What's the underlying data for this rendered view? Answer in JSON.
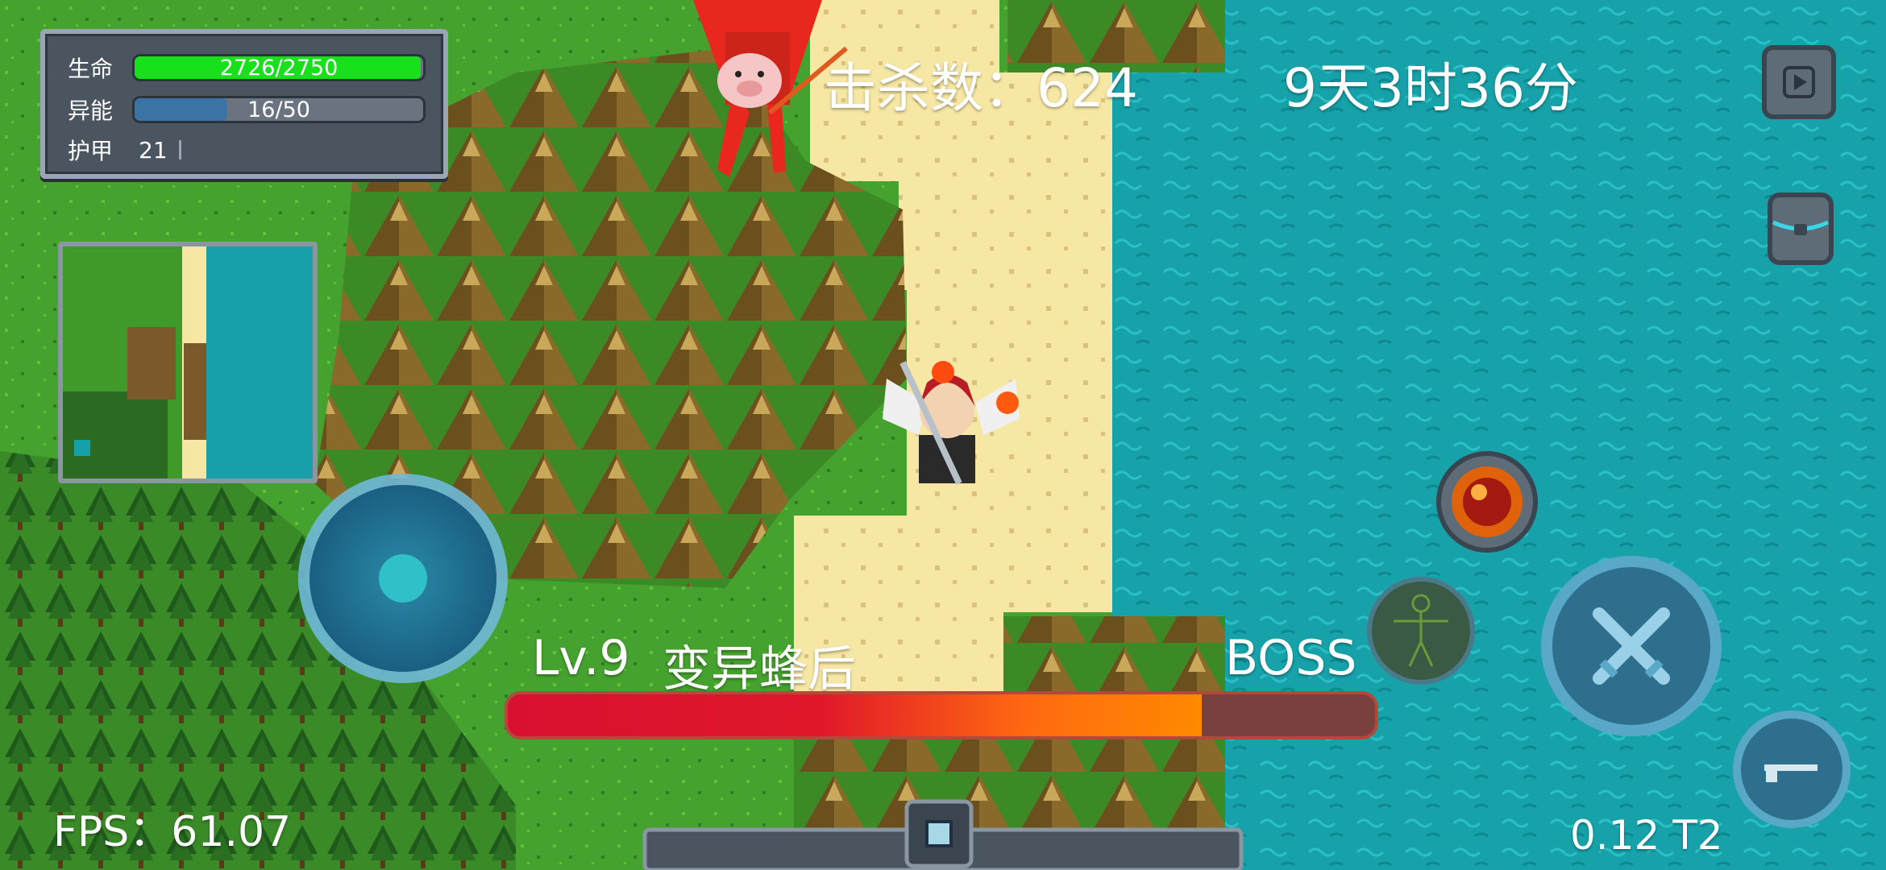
{
  "stats": {
    "hp_label": "生命",
    "hp_value": "2726/2750",
    "hp_fraction": 0.991,
    "energy_label": "异能",
    "energy_value": "16/50",
    "energy_fraction": 0.32,
    "armor_label": "护甲",
    "armor_value": "21"
  },
  "hud": {
    "kill_count": "击杀数：624",
    "game_time": "9天3时36分",
    "fps": "FPS：61.07",
    "version": "0.12 T2"
  },
  "boss": {
    "level": "Lv.9",
    "name": "变异蜂后",
    "tag": "BOSS",
    "hp_fraction": 0.8
  },
  "colors": {
    "hp_green": "#18e01a",
    "energy_blue": "#3b74a4",
    "water": "#1aa0a8",
    "sand": "#f6e7a4",
    "grass": "#46a22e",
    "boss_red": "#d91030",
    "boss_orange": "#ff8a00",
    "boss_blue": "#2f55d6"
  },
  "icons": {
    "play": "play-icon",
    "backpack": "backpack-icon",
    "fireball": "fireball-skill-icon",
    "character": "character-icon",
    "attack": "crossed-swords-icon",
    "weapon": "gun-icon"
  }
}
